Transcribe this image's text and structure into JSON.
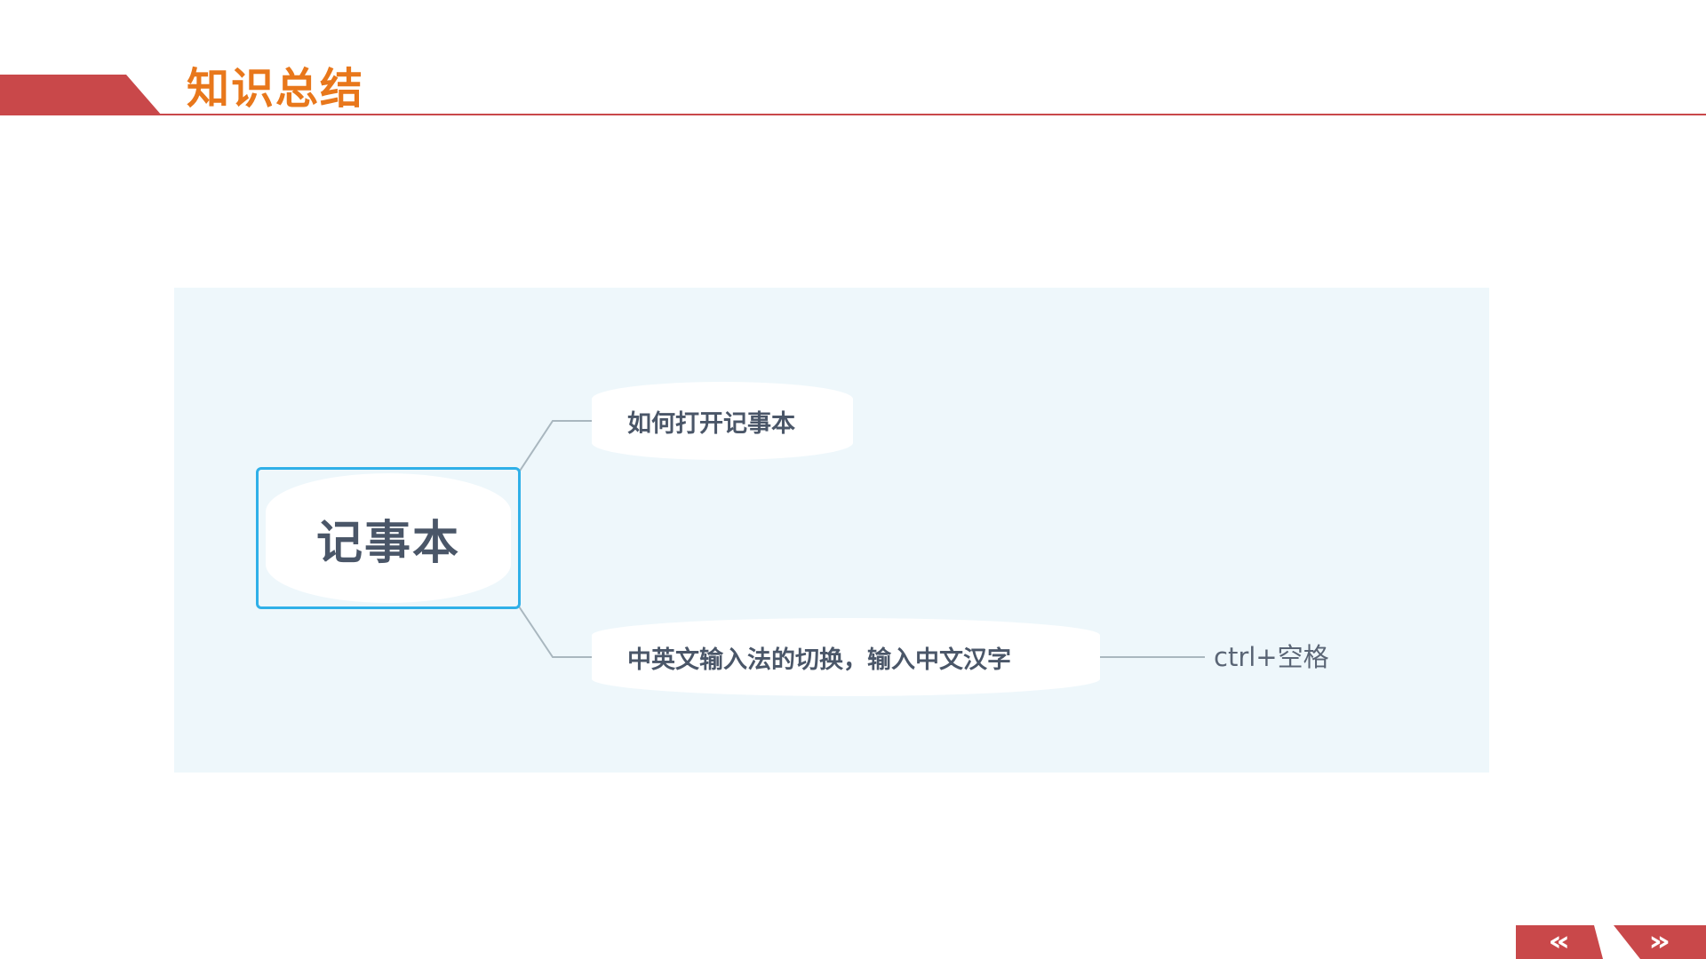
{
  "header": {
    "title": "知识总结"
  },
  "mindmap": {
    "root": "记事本",
    "branches": [
      {
        "label": "如何打开记事本",
        "children": []
      },
      {
        "label": "中英文输入法的切换，输入中文汉字",
        "children": [
          "ctrl+空格"
        ]
      }
    ]
  },
  "nav": {
    "prev_icon": "double-chevron-left-icon",
    "next_icon": "double-chevron-right-icon",
    "prev_glyph": "«",
    "next_glyph": "»"
  },
  "colors": {
    "accent_red": "#c9484a",
    "title_orange": "#e8771b",
    "root_border": "#2fb0e8",
    "panel_bg": "#eef7fb",
    "text": "#4a5668"
  }
}
